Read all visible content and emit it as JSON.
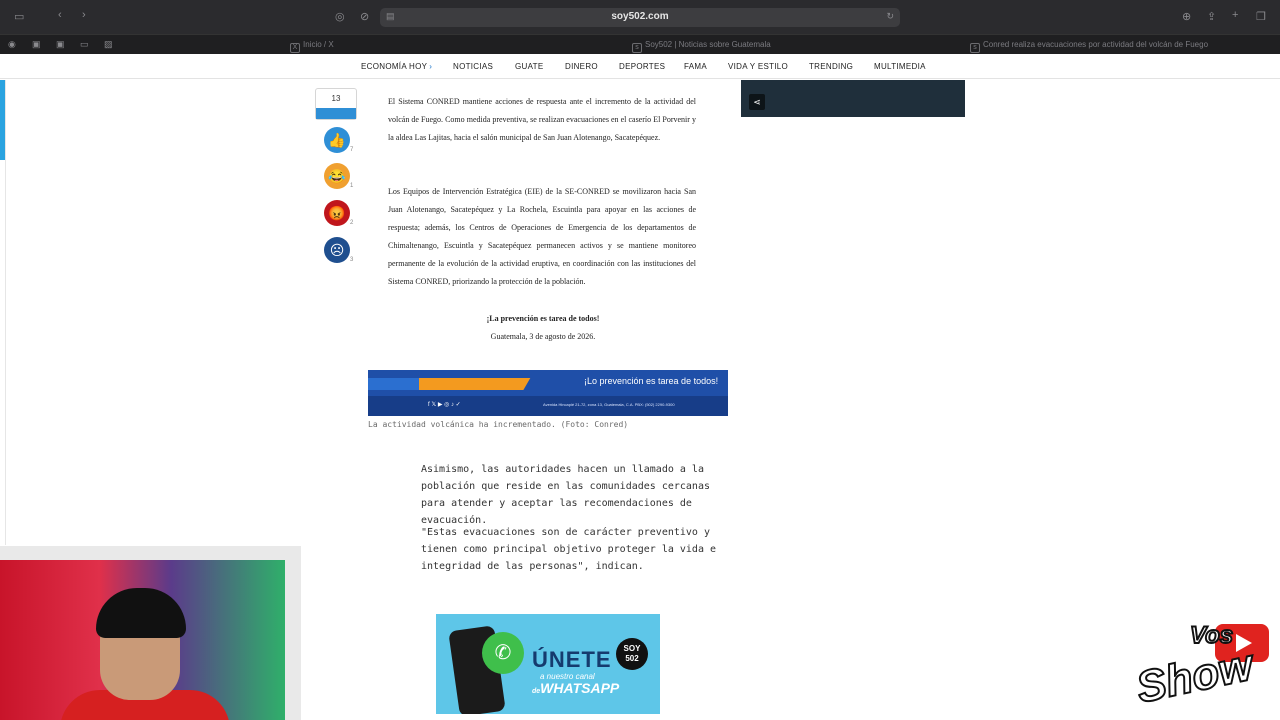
{
  "browser": {
    "url": "soy502.com",
    "tabs": [
      {
        "label": "Inicio / X",
        "icon": "x-icon"
      },
      {
        "label": "Soy502 | Noticias sobre Guatemala",
        "icon": "site-icon"
      },
      {
        "label": "Conred realiza evacuaciones por actividad del volcán de Fuego",
        "icon": "site-icon"
      }
    ]
  },
  "nav": {
    "items": [
      "ECONOMÍA HOY",
      "NOTICIAS",
      "GUATE",
      "DINERO",
      "DEPORTES",
      "FAMA",
      "VIDA Y ESTILO",
      "TRENDING",
      "MULTIMEDIA"
    ]
  },
  "reactions": {
    "total": "13",
    "items": [
      {
        "icon": "thumbs-up-icon",
        "count": "7",
        "color": "#2f8fd6"
      },
      {
        "icon": "crying-laugh-icon",
        "count": "1",
        "color": "#f0a030"
      },
      {
        "icon": "angry-icon",
        "count": "2",
        "color": "#c0161c"
      },
      {
        "icon": "sad-icon",
        "count": "3",
        "color": "#1f4f8f"
      }
    ]
  },
  "document": {
    "p1": "El Sistema CONRED mantiene acciones de respuesta ante el incremento de la actividad del volcán de Fuego. Como medida preventiva, se realizan evacuaciones en el caserío El Porvenir y la aldea Las Lajitas, hacia el salón municipal de San Juan Alotenango, Sacatepéquez.",
    "p2": "Los Equipos de Intervención Estratégica (EIE) de la SE-CONRED se movilizaron hacia San Juan Alotenango, Sacatepéquez y La Rochela, Escuintla para apoyar en las acciones de respuesta; además, los Centros de Operaciones de Emergencia de los departamentos de Chimaltenango, Escuintla y Sacatepéquez permanecen activos y se mantiene monitoreo permanente de la evolución de la actividad eruptiva, en coordinación con las instituciones del Sistema CONRED, priorizando la protección de la población.",
    "slogan": "¡La prevención es tarea de todos!",
    "date": "Guatemala, 3 de agosto de 2026."
  },
  "banner": {
    "slogan": "¡Lo prevención es tarea de todos!",
    "address": "Avenida Hincapié 21-72, zona 13, Guatemala, C.A. PBX: (502) 2290-9300"
  },
  "caption": "La actividad volcánica ha incrementado. (Foto: Conred)",
  "article": {
    "p1": "Asimismo, las autoridades hacen un llamado a la población que reside en las comunidades cercanas para atender y aceptar las recomendaciones de evacuación.",
    "p2": "\"Estas evacuaciones son de carácter preventivo y tienen como principal objetivo proteger la vida e integridad de las personas\", indican."
  },
  "promo": {
    "headline": "ÚNETE",
    "sub": "a nuestro canal",
    "sub2": "de",
    "brand": "WHATSAPP",
    "logo": "SOY 502"
  },
  "channel_logo": {
    "line1": "Vos",
    "line2": "Show"
  }
}
